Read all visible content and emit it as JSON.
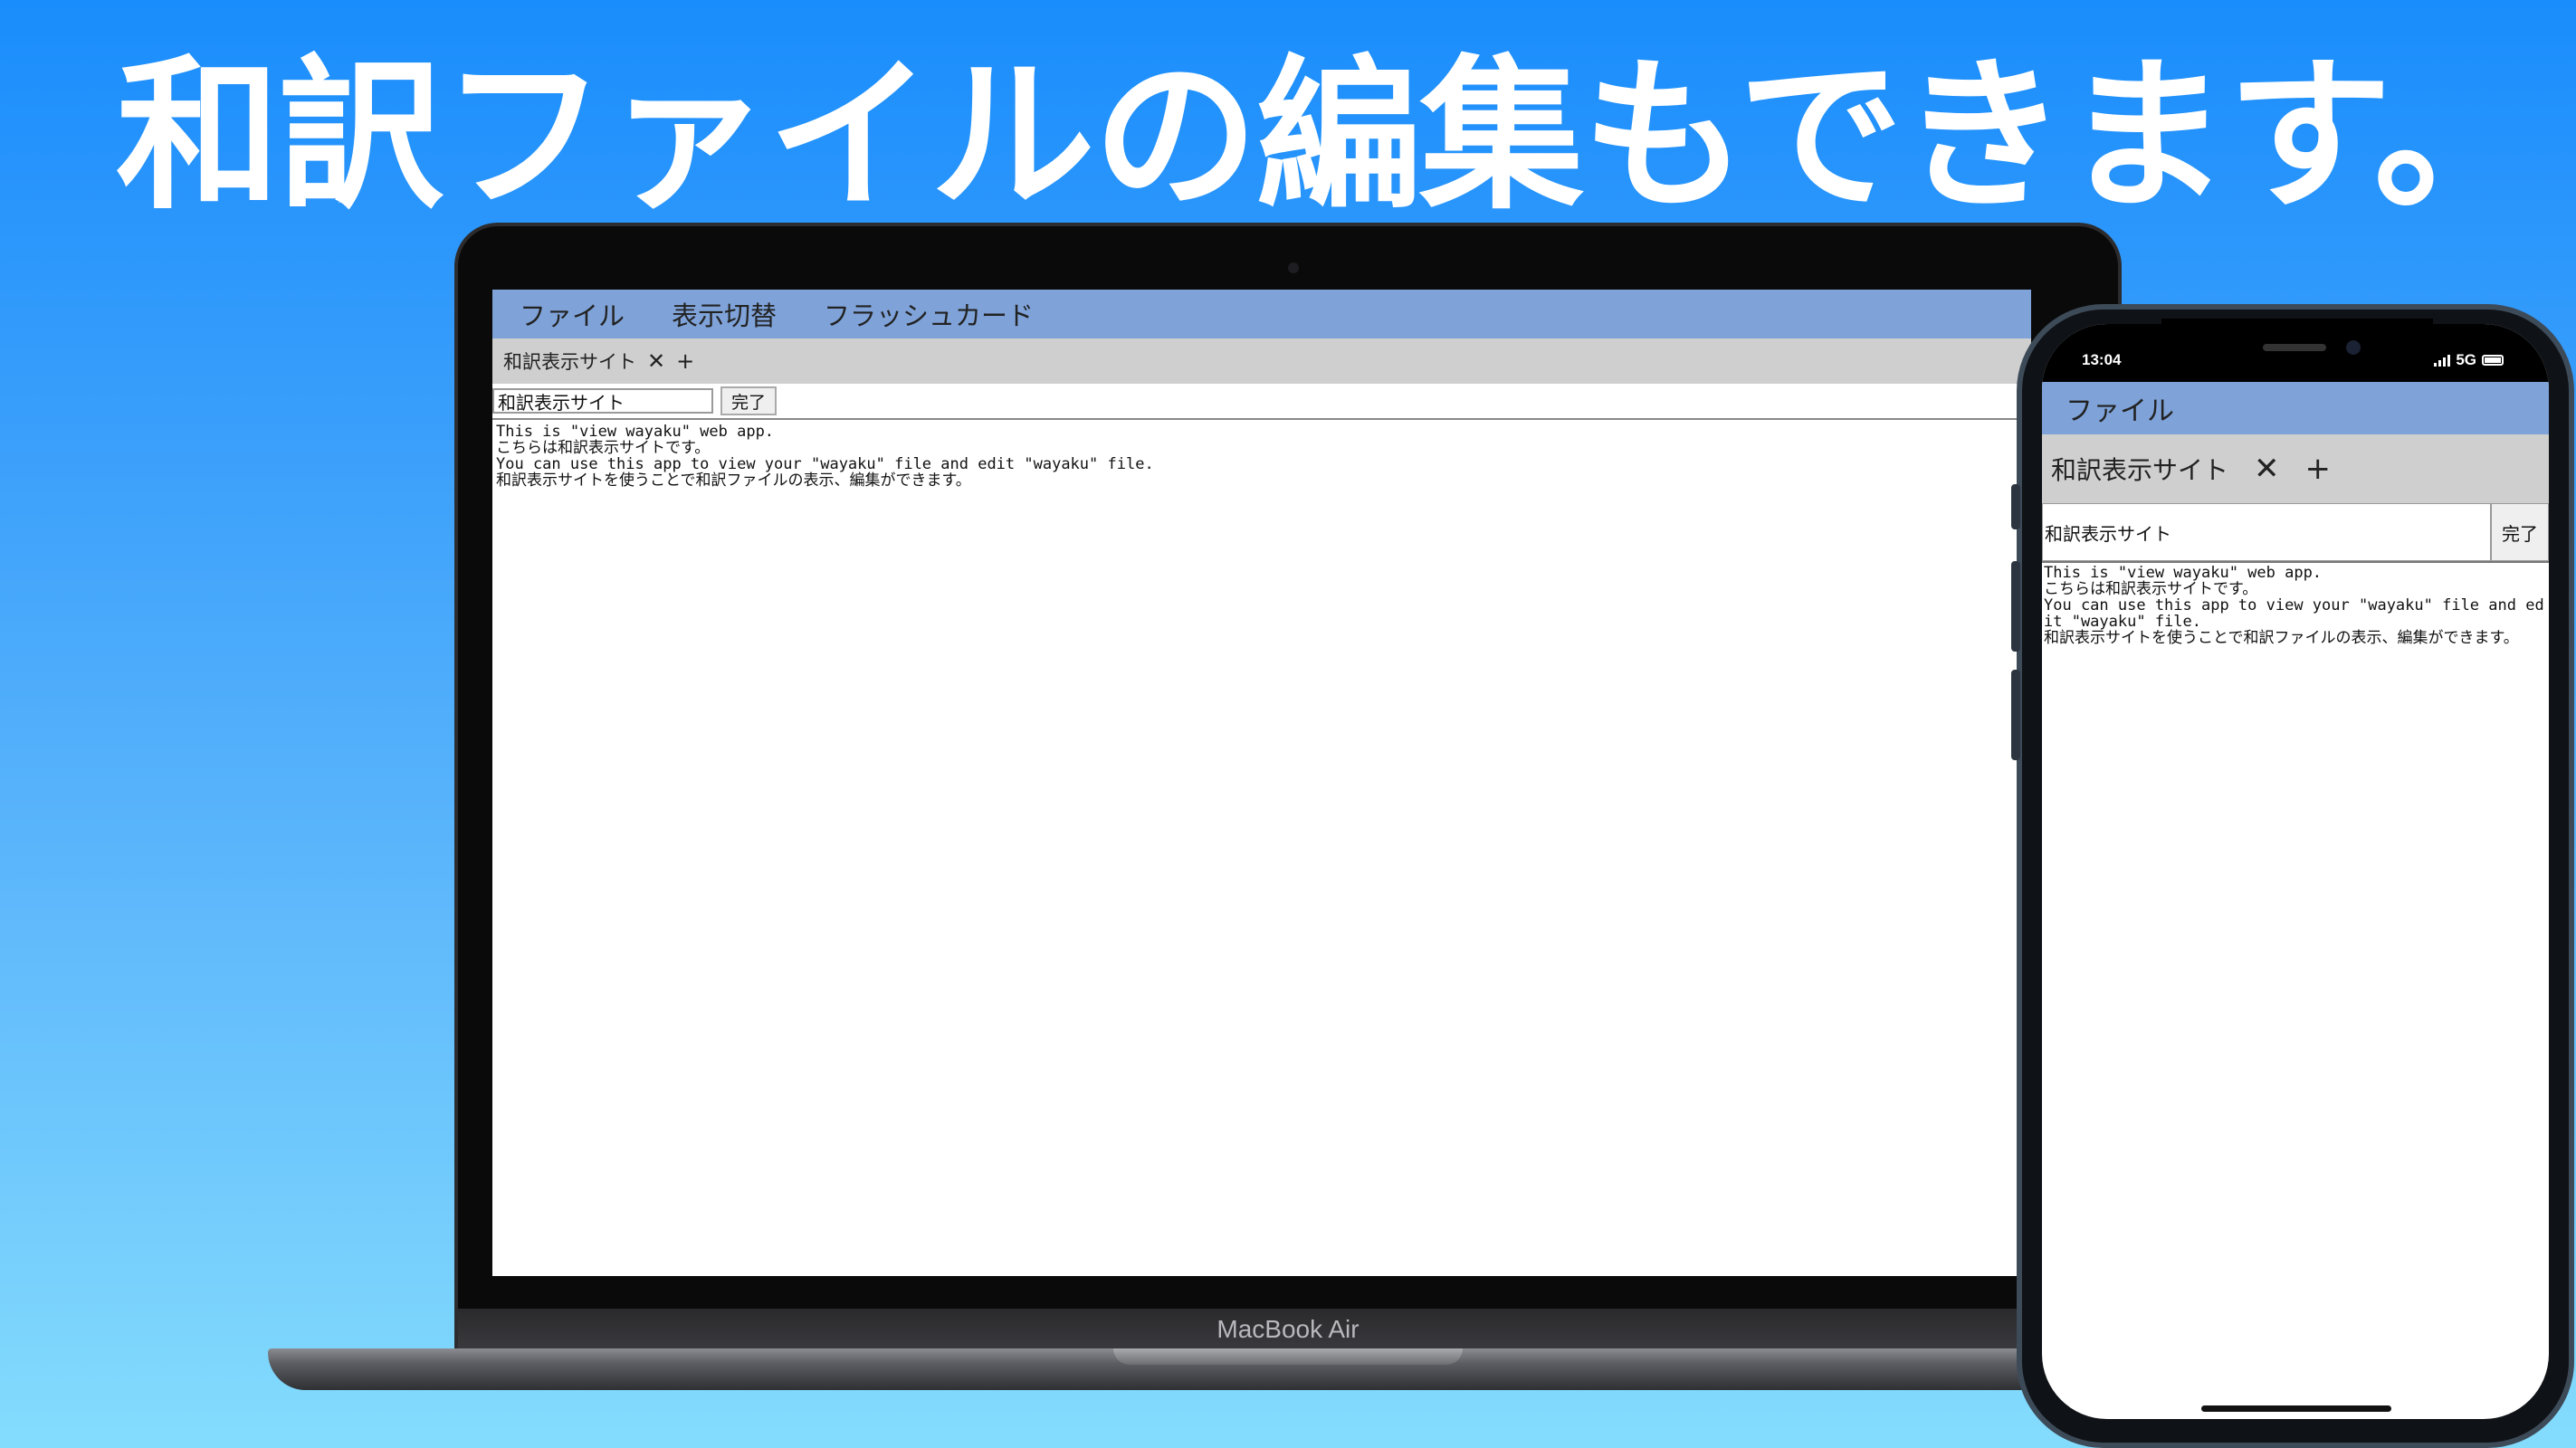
{
  "headline": "和訳ファイルの編集もできます。",
  "laptop": {
    "brand": "MacBook Air",
    "app": {
      "menu": [
        "ファイル",
        "表示切替",
        "フラッシュカード"
      ],
      "tab": {
        "label": "和訳表示サイト",
        "close": "✕",
        "add": "+"
      },
      "title_input": "和訳表示サイト",
      "done_button": "完了",
      "content": [
        "This is \"view wayaku\" web app.",
        "こちらは和訳表示サイトです。",
        "You can use this app to view your  \"wayaku\" file and edit \"wayaku\" file.",
        "和訳表示サイトを使うことで和訳ファイルの表示、編集ができます。"
      ]
    }
  },
  "phone": {
    "status": {
      "time": "13:04",
      "network": "5G"
    },
    "app": {
      "menu": [
        "ファイル"
      ],
      "tab": {
        "label": "和訳表示サイト",
        "close": "✕",
        "add": "+"
      },
      "title_input": "和訳表示サイト",
      "done_button": "完了",
      "content": [
        "This is \"view wayaku\" web app.",
        "こちらは和訳表示サイトです。",
        "You can use this app to view your  \"wayaku\" file and edit \"wayaku\" file.",
        "和訳表示サイトを使うことで和訳ファイルの表示、編集ができます。"
      ]
    }
  }
}
